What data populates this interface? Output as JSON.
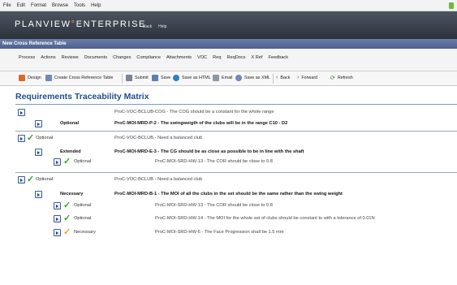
{
  "menubar": {
    "items": [
      "File",
      "Edit",
      "Format",
      "Browse",
      "Tools",
      "Help"
    ]
  },
  "header": {
    "brand_main": "PLANVIEW",
    "brand_accent": "°",
    "brand_tail": "ENTERPRISE",
    "links": [
      "Back",
      "Help"
    ]
  },
  "titlebar": {
    "title": "New Cross Reference Table"
  },
  "tabs": [
    "Process",
    "Actions",
    "Reviews",
    "Documents",
    "Changes",
    "Compliance",
    "Attachments",
    "VOC",
    "Req",
    "ReqDocs",
    "X Ref",
    "Feedback"
  ],
  "toolbar": {
    "design": "Design",
    "create_xref": "Create Cross Reference Table",
    "submit": "Submit",
    "save": "Save",
    "save_html": "Save as HTML",
    "email": "Email",
    "save_xml": "Save as XML",
    "back": "Back",
    "forward": "Forward",
    "refresh": "Refresh"
  },
  "doc": {
    "title": "Requirements Traceability Matrix",
    "rows": [
      {
        "text": "ProC-VOC-BCLUB-COG - The COG should be a constant for the whole range"
      },
      {
        "label": "Optional",
        "text": "ProC-MOI-MRD-P-2 - The swingweigth of the clubs will be in the range C10 - D2"
      },
      {
        "label": "Optional",
        "text": "ProC-VOC-BCLUB - Need a balanced club"
      },
      {
        "label": "Extended",
        "text": "ProC-MOI-MRD-E-3 - The CG should be as close as possible to be in line with the shaft"
      },
      {
        "label": "Optional",
        "text": "ProC-MOI-SRD-HW-13 - The COR should be close to 0.8"
      },
      {
        "label": "Optional",
        "text": "ProC-VOC-BCLUB - Need a balanced club"
      },
      {
        "label": "Necessary",
        "text": "ProC-MOI-MRD-B-1 - The MOI of all the clubs in the set should be the same rather than the swing weight"
      },
      {
        "label": "Optional",
        "text": "ProC-MOI-SRD-HW-13 - The COR should be close to 0.8"
      },
      {
        "label": "Optional",
        "text": "ProC-MOI-SRD-HW-14 - The MOI for the whole set of clubs should be constant to with a tolerance of 0.01N"
      },
      {
        "label": "Necessary",
        "text": "ProC-MOI-SRD-HW-6 - The Face Progression shall be 1.5 mm"
      }
    ]
  },
  "colors": {
    "accent": "#f39a1e",
    "title_blue": "#1f4f8f",
    "check_green": "#3aa12a",
    "check_orange": "#f0a019"
  }
}
